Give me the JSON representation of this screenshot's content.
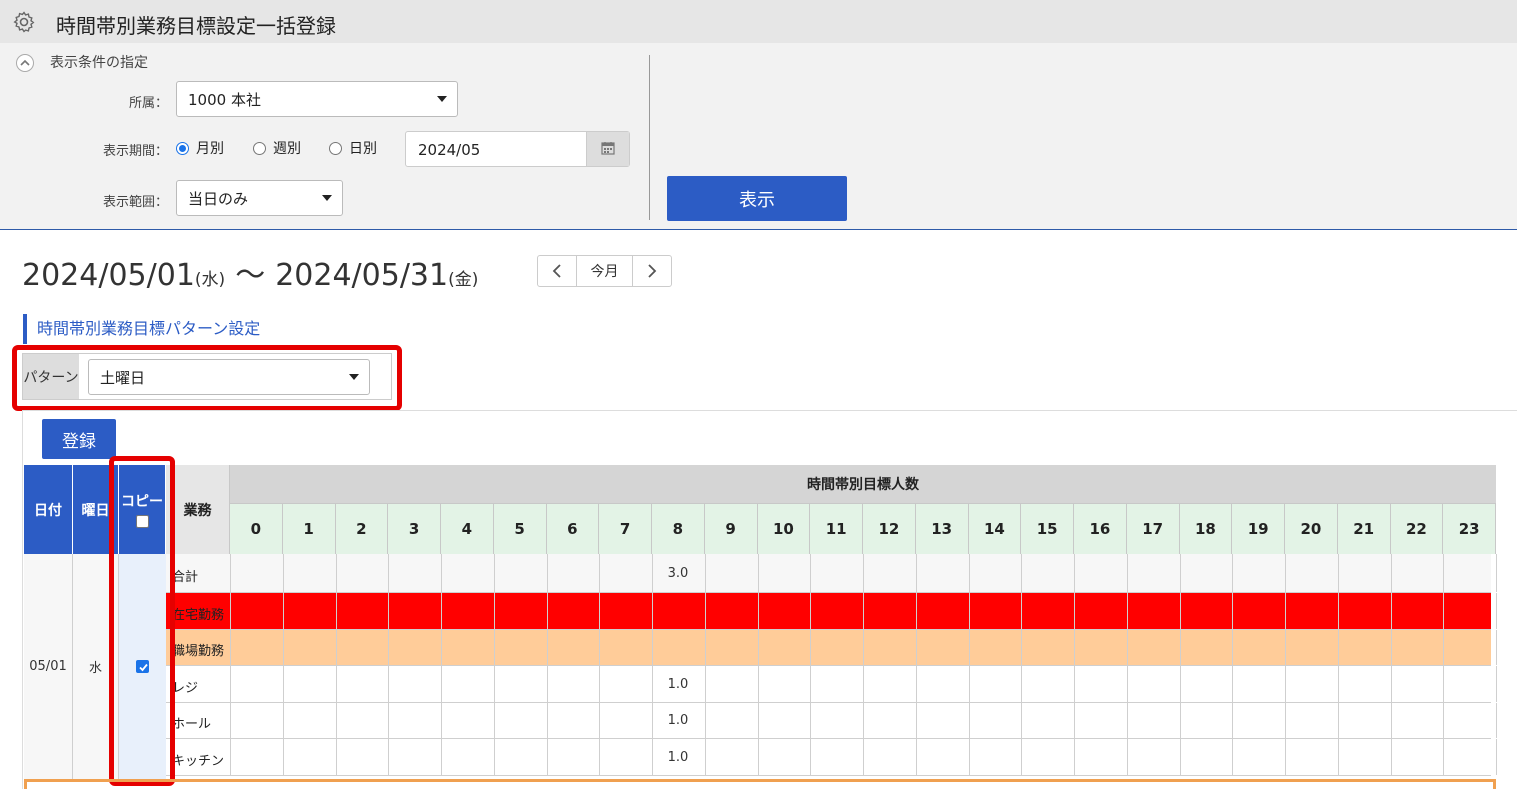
{
  "title": "時間帯別業務目標設定一括登録",
  "conditions": {
    "header": "表示条件の指定",
    "affiliation_label": "所属：",
    "affiliation_value": "1000 本社",
    "period_label": "表示期間：",
    "period_options": [
      "月別",
      "週別",
      "日別"
    ],
    "period_selected": "月別",
    "date_value": "2024/05",
    "scope_label": "表示範囲：",
    "scope_value": "当日のみ",
    "show_button": "表示"
  },
  "range": {
    "start": "2024/05/01",
    "start_dow": "(水)",
    "tilde": "〜",
    "end": "2024/05/31",
    "end_dow": "(金)",
    "nav_current": "今月"
  },
  "pattern_section": {
    "title": "時間帯別業務目標パターン設定",
    "pattern_label": "パターン",
    "pattern_value": "土曜日"
  },
  "register_button": "登録",
  "table": {
    "col_date": "日付",
    "col_dow": "曜日",
    "col_copy": "コピー",
    "col_task": "業務",
    "col_hours_group": "時間帯別目標人数",
    "hours": [
      "0",
      "1",
      "2",
      "3",
      "4",
      "5",
      "6",
      "7",
      "8",
      "9",
      "10",
      "11",
      "12",
      "13",
      "14",
      "15",
      "16",
      "17",
      "18",
      "19",
      "20",
      "21",
      "22",
      "23"
    ],
    "date": "05/01",
    "dow": "水",
    "copy_checked": true,
    "rows": [
      {
        "name": "合計",
        "values": [
          "",
          "",
          "",
          "",
          "",
          "",
          "",
          "",
          "3.0",
          "",
          "",
          "",
          "",
          "",
          "",
          "",
          "",
          "",
          "",
          "",
          "",
          "",
          "",
          ""
        ],
        "bg": "#f7f7f7"
      },
      {
        "name": "在宅勤務",
        "values": [
          "",
          "",
          "",
          "",
          "",
          "",
          "",
          "",
          "",
          "",
          "",
          "",
          "",
          "",
          "",
          "",
          "",
          "",
          "",
          "",
          "",
          "",
          "",
          ""
        ],
        "bg": "#ff0000"
      },
      {
        "name": "職場勤務",
        "values": [
          "",
          "",
          "",
          "",
          "",
          "",
          "",
          "",
          "",
          "",
          "",
          "",
          "",
          "",
          "",
          "",
          "",
          "",
          "",
          "",
          "",
          "",
          "",
          ""
        ],
        "bg": "#ffcc99"
      },
      {
        "name": "レジ",
        "values": [
          "",
          "",
          "",
          "",
          "",
          "",
          "",
          "",
          "1.0",
          "",
          "",
          "",
          "",
          "",
          "",
          "",
          "",
          "",
          "",
          "",
          "",
          "",
          "",
          ""
        ],
        "bg": "#ffffff"
      },
      {
        "name": "ホール",
        "values": [
          "",
          "",
          "",
          "",
          "",
          "",
          "",
          "",
          "1.0",
          "",
          "",
          "",
          "",
          "",
          "",
          "",
          "",
          "",
          "",
          "",
          "",
          "",
          "",
          ""
        ],
        "bg": "#ffffff"
      },
      {
        "name": "キッチン",
        "values": [
          "",
          "",
          "",
          "",
          "",
          "",
          "",
          "",
          "1.0",
          "",
          "",
          "",
          "",
          "",
          "",
          "",
          "",
          "",
          "",
          "",
          "",
          "",
          "",
          ""
        ],
        "bg": "#ffffff"
      }
    ]
  },
  "colors": {
    "accent": "#2c5cc5",
    "highlight_red": "#e50000"
  },
  "icons": {
    "settings": "gear-icon",
    "collapse": "chevron-up-icon",
    "calendar": "calendar-icon",
    "prev": "chevron-left-icon",
    "next": "chevron-right-icon"
  }
}
